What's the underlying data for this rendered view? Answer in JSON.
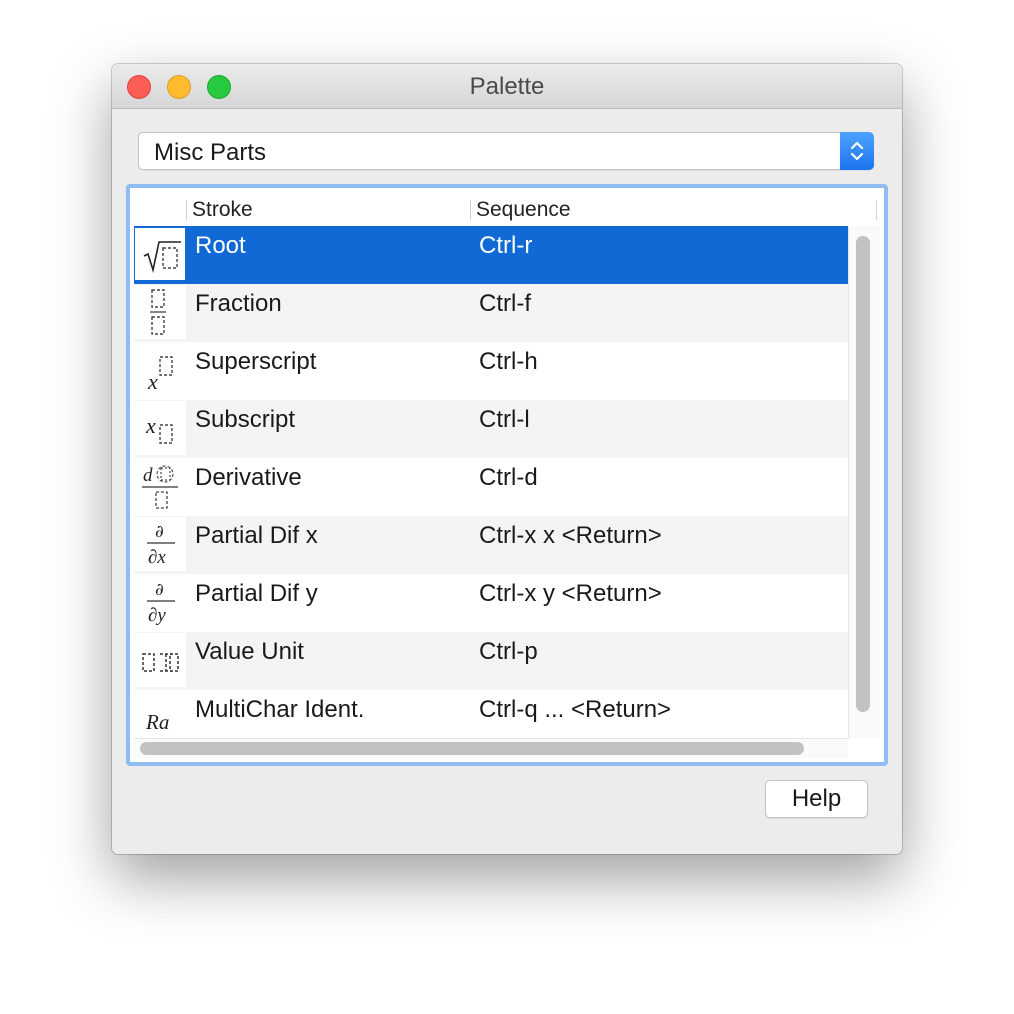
{
  "window": {
    "title": "Palette"
  },
  "category_select": {
    "selected": "Misc Parts"
  },
  "table": {
    "columns": {
      "stroke": "Stroke",
      "sequence": "Sequence"
    },
    "selected_index": 0,
    "rows": [
      {
        "icon": "root-icon",
        "stroke": "Root",
        "sequence": "Ctrl-r"
      },
      {
        "icon": "fraction-icon",
        "stroke": "Fraction",
        "sequence": "Ctrl-f"
      },
      {
        "icon": "superscript-icon",
        "stroke": "Superscript",
        "sequence": "Ctrl-h"
      },
      {
        "icon": "subscript-icon",
        "stroke": "Subscript",
        "sequence": "Ctrl-l"
      },
      {
        "icon": "derivative-icon",
        "stroke": "Derivative",
        "sequence": "Ctrl-d"
      },
      {
        "icon": "partial-dif-x-icon",
        "stroke": "Partial Dif x",
        "sequence": "Ctrl-x x <Return>"
      },
      {
        "icon": "partial-dif-y-icon",
        "stroke": "Partial Dif y",
        "sequence": "Ctrl-x y <Return>"
      },
      {
        "icon": "value-unit-icon",
        "stroke": "Value Unit",
        "sequence": "Ctrl-p"
      },
      {
        "icon": "multichar-ident-icon",
        "stroke": "MultiChar Ident.",
        "sequence": "Ctrl-q ... <Return>"
      }
    ]
  },
  "icon_glyphs": {
    "multichar": "Ra",
    "superscript_base": "x",
    "subscript_base": "x",
    "derivative_d": "d",
    "partial": "∂",
    "partial_x": "∂x",
    "partial_y": "∂y"
  },
  "buttons": {
    "help": "Help"
  },
  "colors": {
    "selection": "#1069d4",
    "focus_ring": "#8fbdf3",
    "stepper": "#1b74f0"
  }
}
